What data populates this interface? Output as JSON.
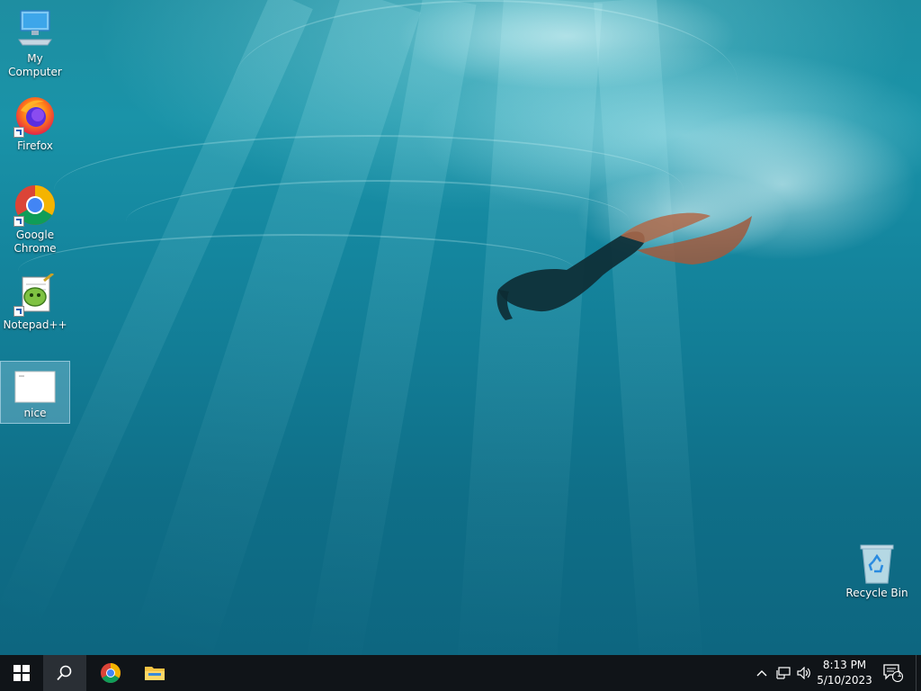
{
  "desktop": {
    "icons": [
      {
        "label": "My Computer",
        "icon": "computer-icon"
      },
      {
        "label": "Firefox",
        "icon": "firefox-icon"
      },
      {
        "label": "Google Chrome",
        "icon": "chrome-icon"
      },
      {
        "label": "Notepad++",
        "icon": "notepadpp-icon"
      },
      {
        "label": "nice",
        "icon": "file-icon",
        "selected": true
      },
      {
        "label": "Recycle Bin",
        "icon": "recycle-bin-icon"
      }
    ]
  },
  "taskbar": {
    "pinned": [
      {
        "name": "start",
        "icon": "windows-logo-icon"
      },
      {
        "name": "search",
        "icon": "search-icon",
        "active": true
      },
      {
        "name": "chrome",
        "icon": "chrome-icon"
      },
      {
        "name": "file-explorer",
        "icon": "folder-icon"
      }
    ],
    "tray": {
      "icons": [
        "chevron-up-icon",
        "network-icon",
        "volume-icon"
      ],
      "time": "8:13 PM",
      "date": "5/10/2023",
      "notification_count": "1"
    }
  },
  "colors": {
    "taskbar_bg": "#101418",
    "water_top": "#1e8ea1",
    "water_bottom": "#0d6680",
    "chrome_red": "#db4437",
    "chrome_green": "#0f9d58",
    "chrome_yellow": "#f4b400",
    "chrome_blue": "#4285f4"
  }
}
